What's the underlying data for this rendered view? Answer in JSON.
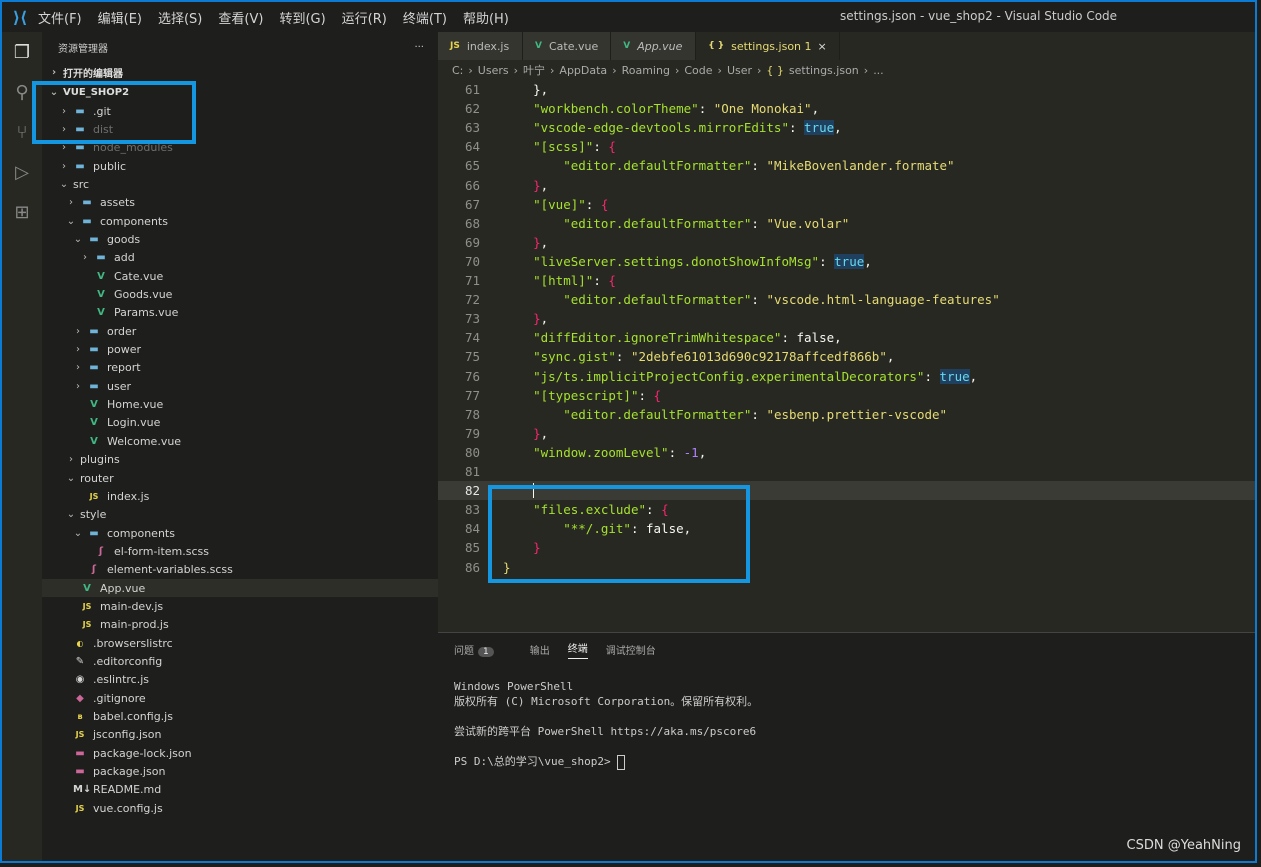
{
  "window": {
    "title": "settings.json - vue_shop2 - Visual Studio Code",
    "menu": [
      "文件(F)",
      "编辑(E)",
      "选择(S)",
      "查看(V)",
      "转到(G)",
      "运行(R)",
      "终端(T)",
      "帮助(H)"
    ]
  },
  "sidebar": {
    "title": "资源管理器",
    "more": "···",
    "open_editors": "打开的编辑器",
    "project": "VUE_SHOP2",
    "tree": [
      {
        "label": ".git",
        "icon": "folder-icon",
        "indent": 0,
        "chev": "›",
        "dim": false
      },
      {
        "label": "dist",
        "icon": "folder-icon",
        "indent": 0,
        "chev": "›",
        "dim": true
      },
      {
        "label": "node_modules",
        "icon": "folder-icon",
        "indent": 0,
        "chev": "›",
        "dim": true
      },
      {
        "label": "public",
        "icon": "folder-icon",
        "indent": 0,
        "chev": "›",
        "dim": false
      },
      {
        "label": "src",
        "icon": "none",
        "indent": 0,
        "chev": "⌄",
        "dim": false
      },
      {
        "label": "assets",
        "icon": "folder-icon",
        "indent": 1,
        "chev": "›",
        "dim": false
      },
      {
        "label": "components",
        "icon": "folder-icon",
        "indent": 1,
        "chev": "⌄",
        "dim": false
      },
      {
        "label": "goods",
        "icon": "folder-icon",
        "indent": 2,
        "chev": "⌄",
        "dim": false
      },
      {
        "label": "add",
        "icon": "folder-icon",
        "indent": 3,
        "chev": "›",
        "dim": false
      },
      {
        "label": "Cate.vue",
        "icon": "vue-icon",
        "indent": 3,
        "chev": "",
        "dim": false
      },
      {
        "label": "Goods.vue",
        "icon": "vue-icon",
        "indent": 3,
        "chev": "",
        "dim": false
      },
      {
        "label": "Params.vue",
        "icon": "vue-icon",
        "indent": 3,
        "chev": "",
        "dim": false
      },
      {
        "label": "order",
        "icon": "folder-icon",
        "indent": 2,
        "chev": "›",
        "dim": false
      },
      {
        "label": "power",
        "icon": "folder-icon",
        "indent": 2,
        "chev": "›",
        "dim": false
      },
      {
        "label": "report",
        "icon": "folder-icon",
        "indent": 2,
        "chev": "›",
        "dim": false
      },
      {
        "label": "user",
        "icon": "folder-icon",
        "indent": 2,
        "chev": "›",
        "dim": false
      },
      {
        "label": "Home.vue",
        "icon": "vue-icon",
        "indent": 2,
        "chev": "",
        "dim": false
      },
      {
        "label": "Login.vue",
        "icon": "vue-icon",
        "indent": 2,
        "chev": "",
        "dim": false
      },
      {
        "label": "Welcome.vue",
        "icon": "vue-icon",
        "indent": 2,
        "chev": "",
        "dim": false
      },
      {
        "label": "plugins",
        "icon": "none",
        "indent": 1,
        "chev": "›",
        "dim": false
      },
      {
        "label": "router",
        "icon": "none",
        "indent": 1,
        "chev": "⌄",
        "dim": false
      },
      {
        "label": "index.js",
        "icon": "js-icon",
        "indent": 2,
        "chev": "",
        "dim": false
      },
      {
        "label": "style",
        "icon": "none",
        "indent": 1,
        "chev": "⌄",
        "dim": false
      },
      {
        "label": "components",
        "icon": "folder-icon",
        "indent": 2,
        "chev": "⌄",
        "dim": false
      },
      {
        "label": "el-form-item.scss",
        "icon": "scss-icon",
        "indent": 3,
        "chev": "",
        "dim": false
      },
      {
        "label": "element-variables.scss",
        "icon": "scss-icon",
        "indent": 2,
        "chev": "",
        "dim": false
      },
      {
        "label": "App.vue",
        "icon": "vue-icon",
        "indent": 1,
        "chev": "",
        "dim": false,
        "selected": true
      },
      {
        "label": "main-dev.js",
        "icon": "js-icon",
        "indent": 1,
        "chev": "",
        "dim": false
      },
      {
        "label": "main-prod.js",
        "icon": "js-icon",
        "indent": 1,
        "chev": "",
        "dim": false
      },
      {
        "label": ".browserslistrc",
        "icon": "browserslist-icon",
        "indent": 0,
        "chev": "",
        "dim": false
      },
      {
        "label": ".editorconfig",
        "icon": "editorconfig-icon",
        "indent": 0,
        "chev": "",
        "dim": false
      },
      {
        "label": ".eslintrc.js",
        "icon": "eslint-icon",
        "indent": 0,
        "chev": "",
        "dim": false
      },
      {
        "label": ".gitignore",
        "icon": "git-icon",
        "indent": 0,
        "chev": "",
        "dim": false
      },
      {
        "label": "babel.config.js",
        "icon": "babel-icon",
        "indent": 0,
        "chev": "",
        "dim": false
      },
      {
        "label": "jsconfig.json",
        "icon": "js-icon",
        "indent": 0,
        "chev": "",
        "dim": false
      },
      {
        "label": "package-lock.json",
        "icon": "npm-icon",
        "indent": 0,
        "chev": "",
        "dim": false
      },
      {
        "label": "package.json",
        "icon": "npm-icon",
        "indent": 0,
        "chev": "",
        "dim": false
      },
      {
        "label": "README.md",
        "icon": "markdown-icon",
        "indent": 0,
        "chev": "",
        "dim": false
      },
      {
        "label": "vue.config.js",
        "icon": "js-icon",
        "indent": 0,
        "chev": "",
        "dim": false
      }
    ]
  },
  "tabs": [
    {
      "label": "index.js",
      "icon": "JS"
    },
    {
      "label": "Cate.vue",
      "icon": "V"
    },
    {
      "label": "App.vue",
      "icon": "V"
    },
    {
      "label": "settings.json 1",
      "icon": "{ }",
      "active": true,
      "close": "×"
    }
  ],
  "breadcrumb": [
    "C:",
    "›",
    "Users",
    "›",
    "叶宁",
    "›",
    "AppData",
    "›",
    "Roaming",
    "›",
    "Code",
    "›",
    "User",
    "›",
    "{ }",
    "settings.json",
    "›",
    "..."
  ],
  "code_lines": [
    {
      "n": "61",
      "parts": [
        [
          "p",
          "    },"
        ]
      ]
    },
    {
      "n": "62",
      "parts": [
        [
          "p",
          "    "
        ],
        [
          "k",
          "\"workbench.colorTheme\""
        ],
        [
          "p",
          ": "
        ],
        [
          "s",
          "\"One Monokai\""
        ],
        [
          "p",
          ","
        ]
      ]
    },
    {
      "n": "63",
      "parts": [
        [
          "p",
          "    "
        ],
        [
          "k",
          "\"vscode-edge-devtools.mirrorEdits\""
        ],
        [
          "p",
          ": "
        ],
        [
          "bt",
          "true"
        ],
        [
          "p",
          ","
        ]
      ]
    },
    {
      "n": "64",
      "parts": [
        [
          "p",
          "    "
        ],
        [
          "k",
          "\"[scss]\""
        ],
        [
          "p",
          ": "
        ],
        [
          "br",
          "{"
        ]
      ]
    },
    {
      "n": "65",
      "parts": [
        [
          "p",
          "        "
        ],
        [
          "k",
          "\"editor.defaultFormatter\""
        ],
        [
          "p",
          ": "
        ],
        [
          "s",
          "\"MikeBovenlander.formate\""
        ]
      ]
    },
    {
      "n": "66",
      "parts": [
        [
          "br",
          "    }"
        ],
        [
          "p",
          ","
        ]
      ]
    },
    {
      "n": "67",
      "parts": [
        [
          "p",
          "    "
        ],
        [
          "k",
          "\"[vue]\""
        ],
        [
          "p",
          ": "
        ],
        [
          "br",
          "{"
        ]
      ]
    },
    {
      "n": "68",
      "parts": [
        [
          "p",
          "        "
        ],
        [
          "k",
          "\"editor.defaultFormatter\""
        ],
        [
          "p",
          ": "
        ],
        [
          "s",
          "\"Vue.volar\""
        ]
      ]
    },
    {
      "n": "69",
      "parts": [
        [
          "br",
          "    }"
        ],
        [
          "p",
          ","
        ]
      ]
    },
    {
      "n": "70",
      "parts": [
        [
          "p",
          "    "
        ],
        [
          "k",
          "\"liveServer.settings.donotShowInfoMsg\""
        ],
        [
          "p",
          ": "
        ],
        [
          "bt",
          "true"
        ],
        [
          "p",
          ","
        ]
      ]
    },
    {
      "n": "71",
      "parts": [
        [
          "p",
          "    "
        ],
        [
          "k",
          "\"[html]\""
        ],
        [
          "p",
          ": "
        ],
        [
          "br",
          "{"
        ]
      ]
    },
    {
      "n": "72",
      "parts": [
        [
          "p",
          "        "
        ],
        [
          "k",
          "\"editor.defaultFormatter\""
        ],
        [
          "p",
          ": "
        ],
        [
          "s",
          "\"vscode.html-language-features\""
        ]
      ]
    },
    {
      "n": "73",
      "parts": [
        [
          "br",
          "    }"
        ],
        [
          "p",
          ","
        ]
      ]
    },
    {
      "n": "74",
      "parts": [
        [
          "p",
          "    "
        ],
        [
          "k",
          "\"diffEditor.ignoreTrimWhitespace\""
        ],
        [
          "p",
          ": false,"
        ]
      ]
    },
    {
      "n": "75",
      "parts": [
        [
          "p",
          "    "
        ],
        [
          "k",
          "\"sync.gist\""
        ],
        [
          "p",
          ": "
        ],
        [
          "s",
          "\"2debfe61013d690c92178affcedf866b\""
        ],
        [
          "p",
          ","
        ]
      ]
    },
    {
      "n": "76",
      "parts": [
        [
          "p",
          "    "
        ],
        [
          "k",
          "\"js/ts.implicitProjectConfig.experimentalDecorators\""
        ],
        [
          "p",
          ": "
        ],
        [
          "bt",
          "true"
        ],
        [
          "p",
          ","
        ]
      ]
    },
    {
      "n": "77",
      "parts": [
        [
          "p",
          "    "
        ],
        [
          "k",
          "\"[typescript]\""
        ],
        [
          "p",
          ": "
        ],
        [
          "br",
          "{"
        ]
      ]
    },
    {
      "n": "78",
      "parts": [
        [
          "p",
          "        "
        ],
        [
          "k",
          "\"editor.defaultFormatter\""
        ],
        [
          "p",
          ": "
        ],
        [
          "s",
          "\"esbenp.prettier-vscode\""
        ]
      ]
    },
    {
      "n": "79",
      "parts": [
        [
          "br",
          "    }"
        ],
        [
          "p",
          ","
        ]
      ]
    },
    {
      "n": "80",
      "parts": [
        [
          "p",
          "    "
        ],
        [
          "k",
          "\"window.zoomLevel\""
        ],
        [
          "p",
          ": "
        ],
        [
          "num",
          "-1"
        ],
        [
          "p",
          ","
        ]
      ]
    },
    {
      "n": "81",
      "parts": []
    },
    {
      "n": "82",
      "parts": [
        [
          "p",
          "    "
        ]
      ],
      "current": true
    },
    {
      "n": "83",
      "parts": [
        [
          "p",
          "    "
        ],
        [
          "k",
          "\"files.exclude\""
        ],
        [
          "p",
          ": "
        ],
        [
          "br",
          "{"
        ]
      ]
    },
    {
      "n": "84",
      "parts": [
        [
          "p",
          "        "
        ],
        [
          "k",
          "\"**/.git\""
        ],
        [
          "p",
          ": false,"
        ]
      ]
    },
    {
      "n": "85",
      "parts": [
        [
          "br",
          "    }"
        ]
      ]
    },
    {
      "n": "86",
      "parts": [
        [
          "s",
          "}"
        ]
      ]
    }
  ],
  "panel": {
    "tabs": [
      "问题",
      "输出",
      "终端",
      "调试控制台"
    ],
    "problems_count": "1",
    "active": "终端",
    "terminal": [
      "Windows PowerShell",
      "版权所有 (C) Microsoft Corporation。保留所有权利。",
      "",
      "尝试新的跨平台 PowerShell https://aka.ms/pscore6",
      "",
      "PS D:\\总的学习\\vue_shop2> "
    ]
  },
  "watermark": "CSDN @YeahNing",
  "colors": {
    "accent": "#0b7bd3",
    "highlight": "#1497e0",
    "editor_bg": "#272822"
  }
}
